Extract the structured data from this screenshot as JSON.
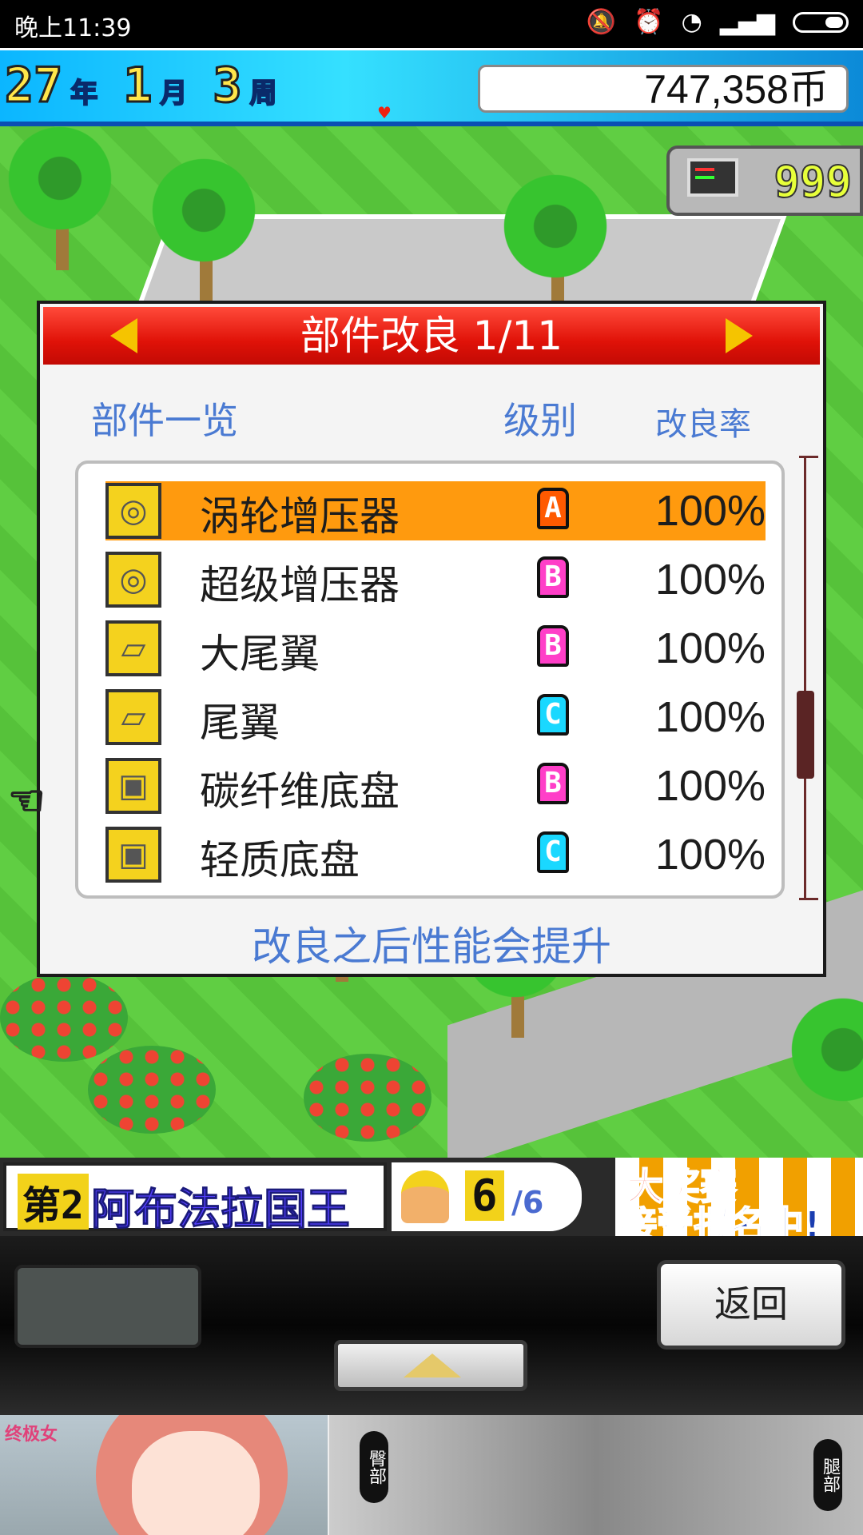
{
  "statusbar": {
    "time": "晚上11:39"
  },
  "topbar": {
    "year": "27",
    "year_unit": "年",
    "month": "1",
    "month_unit": "月",
    "week": "3",
    "week_unit": "周",
    "money": "747,358币"
  },
  "research_points": "999",
  "dialog": {
    "title": "部件改良 1/11",
    "col_parts": "部件一览",
    "col_grade": "级别",
    "col_rate": "改良率",
    "items": [
      {
        "name": "涡轮增压器",
        "grade": "A",
        "grade_color": "#ff5a00",
        "rate": "100%",
        "icon": "turbo-icon"
      },
      {
        "name": "超级增压器",
        "grade": "B",
        "grade_color": "#ff3fc8",
        "rate": "100%",
        "icon": "turbo-icon"
      },
      {
        "name": "大尾翼",
        "grade": "B",
        "grade_color": "#ff3fc8",
        "rate": "100%",
        "icon": "wing-icon"
      },
      {
        "name": "尾翼",
        "grade": "C",
        "grade_color": "#1ad8ff",
        "rate": "100%",
        "icon": "wing-icon"
      },
      {
        "name": "碳纤维底盘",
        "grade": "B",
        "grade_color": "#ff3fc8",
        "rate": "100%",
        "icon": "chassis-icon"
      },
      {
        "name": "轻质底盘",
        "grade": "C",
        "grade_color": "#1ad8ff",
        "rate": "100%",
        "icon": "chassis-icon"
      }
    ],
    "footer": "改良之后性能会提升"
  },
  "bottom_info": {
    "rank": "第2",
    "team_name": "阿布法拉国王",
    "staff_count": "6",
    "staff_total": "/6",
    "promo_line1": "大奖赛",
    "promo_line2": "接受报名中!"
  },
  "controls": {
    "back_label": "返回"
  },
  "ad": {
    "logo": "终极女",
    "tag1": "臀部",
    "tag2": "腿部"
  }
}
